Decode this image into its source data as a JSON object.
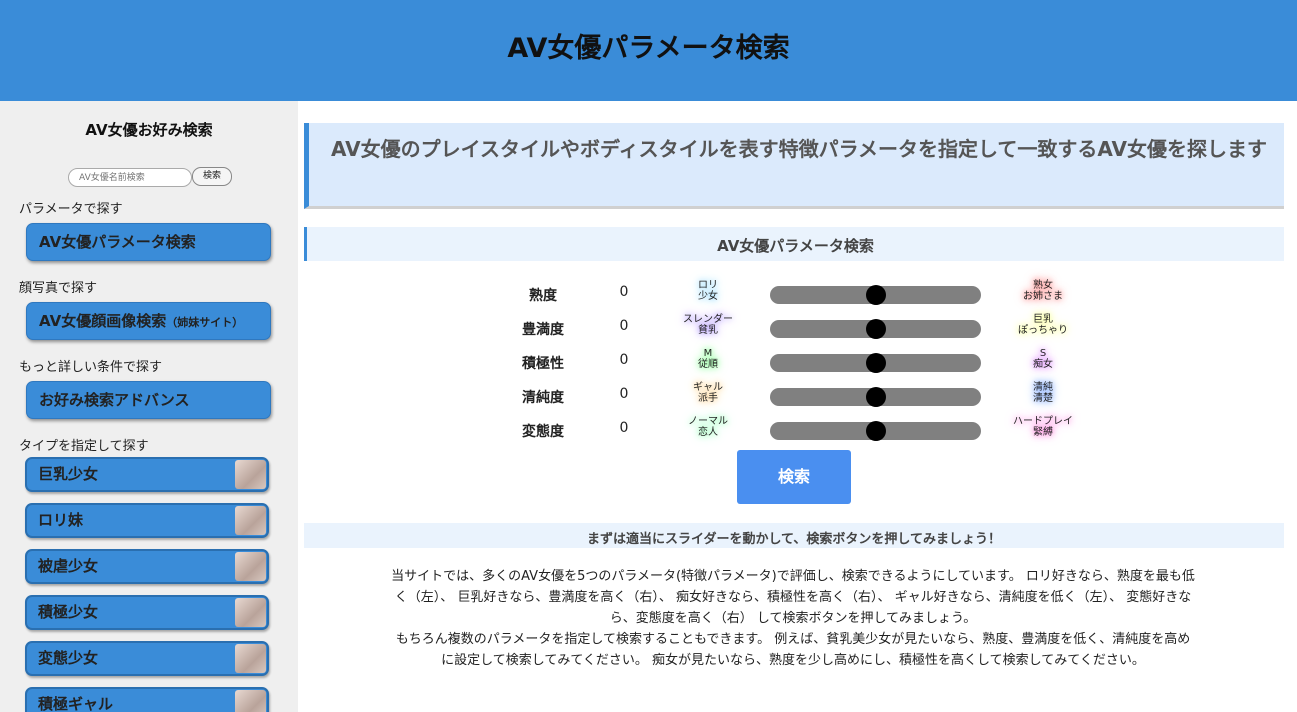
{
  "header": {
    "title": "AV女優パラメータ検索"
  },
  "sidebar": {
    "title": "AV女優お好み検索",
    "search": {
      "placeholder": "AV女優名前検索",
      "button": "検索"
    },
    "sections": [
      {
        "label": "パラメータで探す",
        "button": "AV女優パラメータ検索",
        "note": ""
      },
      {
        "label": "顔写真で探す",
        "button": "AV女優顔画像検索",
        "note": "（姉妹サイト）"
      },
      {
        "label": "もっと詳しい条件で探す",
        "button": "お好み検索アドバンス",
        "note": ""
      }
    ],
    "types_label": "タイプを指定して探す",
    "types": [
      "巨乳少女",
      "ロリ妹",
      "被虐少女",
      "積極少女",
      "変態少女",
      "積極ギャル"
    ]
  },
  "main": {
    "intro": "AV女優のプレイスタイルやボディスタイルを表す特徴パラメータを指定して一致するAV女優を探します",
    "panel_title": "AV女優パラメータ検索",
    "params": [
      {
        "label": "熟度",
        "value": "0",
        "left": "ロリ\n少女",
        "right": "熟女\nお姉さま",
        "left_color": "#6ecbff",
        "right_color": "#ff6b6b",
        "level": 0.5
      },
      {
        "label": "豊満度",
        "value": "0",
        "left": "スレンダー\n貧乳",
        "right": "巨乳\nぽっちゃり",
        "left_color": "#9b7bff",
        "right_color": "#f3ff6b",
        "level": 0.5
      },
      {
        "label": "積極性",
        "value": "0",
        "left": "M\n従順",
        "right": "S\n痴女",
        "left_color": "#6bff7b",
        "right_color": "#d36bff",
        "level": 0.5
      },
      {
        "label": "清純度",
        "value": "0",
        "left": "ギャル\n派手",
        "right": "清純\n清楚",
        "left_color": "#ffc46b",
        "right_color": "#6b9bff",
        "level": 0.5
      },
      {
        "label": "変態度",
        "value": "0",
        "left": "ノーマル\n恋人",
        "right": "ハードプレイ\n緊縛",
        "left_color": "#6bff9b",
        "right_color": "#ff6bd6",
        "level": 0.5
      }
    ],
    "search_button": "検索",
    "hint": "まずは適当にスライダーを動かして、検索ボタンを押してみましょう！",
    "description": [
      "当サイトでは、多くのAV女優を5つのパラメータ(特徴パラメータ)で評価し、検索できるようにしています。 ロリ好きなら、熟度を最も低く（左）、 巨乳好きなら、豊満度を高く（右）、 痴女好きなら、積極性を高く（右）、 ギャル好きなら、清純度を低く（左）、 変態好きなら、変態度を高く（右） して検索ボタンを押してみましょう。",
      "もちろん複数のパラメータを指定して検索することもできます。 例えば、貧乳美少女が見たいなら、熟度、豊満度を低く、清純度を高めに設定して検索してみてください。 痴女が見たいなら、熟度を少し高めにし、積極性を高くして検索してみてください。"
    ]
  }
}
